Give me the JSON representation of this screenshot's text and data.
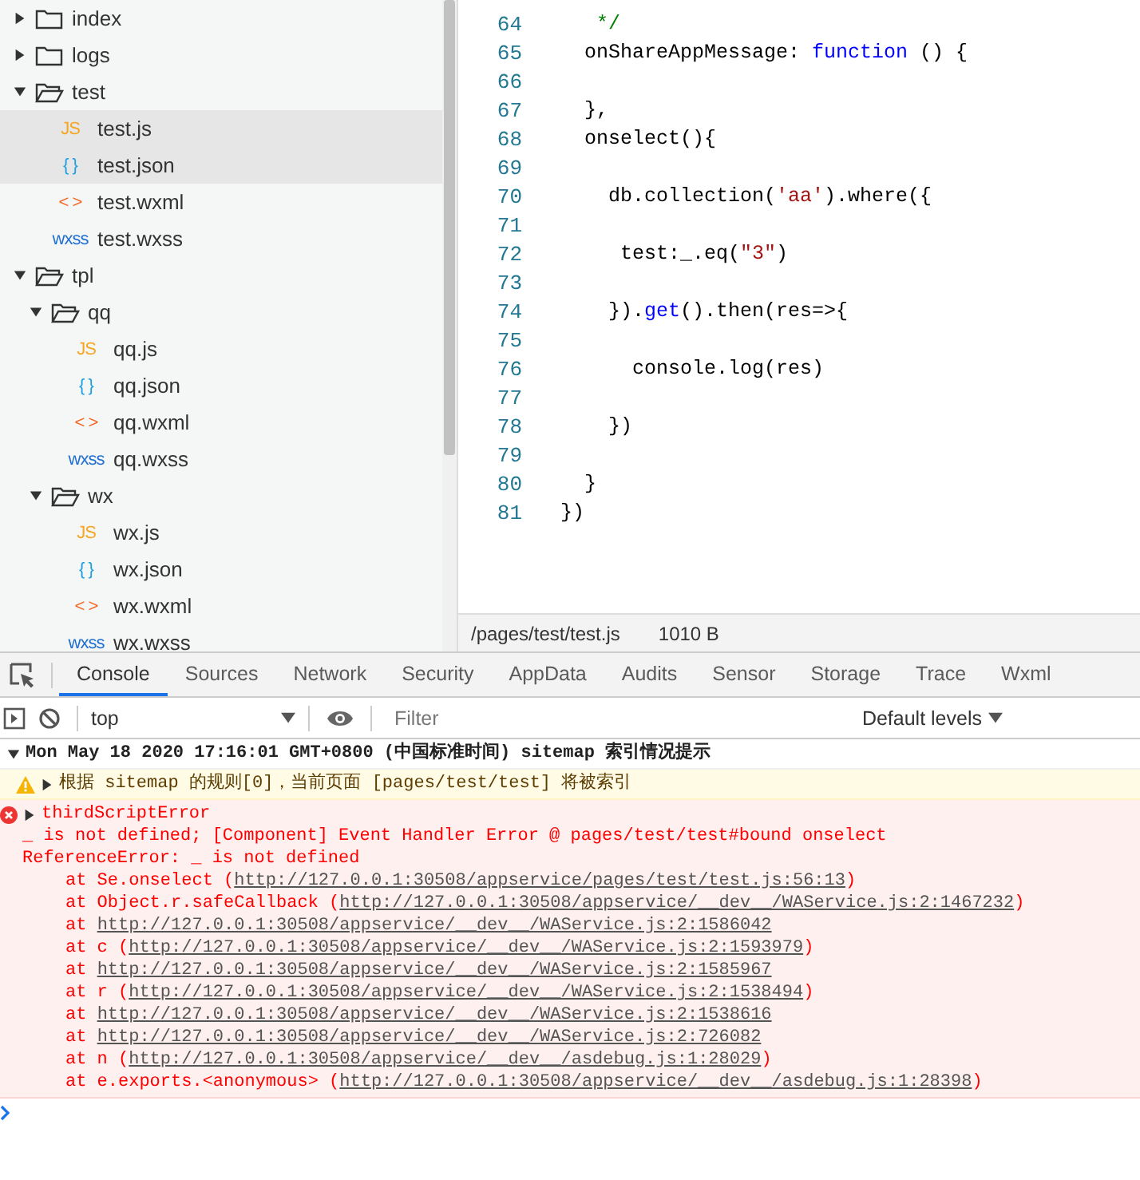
{
  "file_tree": [
    {
      "name": "index",
      "kind": "folder",
      "expanded": false,
      "selected": false
    },
    {
      "name": "logs",
      "kind": "folder",
      "expanded": false,
      "selected": false
    },
    {
      "name": "test",
      "kind": "folder",
      "expanded": true,
      "selected": false,
      "children": [
        {
          "name": "test.js",
          "kind": "js",
          "icon": "JS",
          "selected": true
        },
        {
          "name": "test.json",
          "kind": "json",
          "icon": "{ }",
          "selected": true
        },
        {
          "name": "test.wxml",
          "kind": "wxml",
          "icon": "< >",
          "selected": false
        },
        {
          "name": "test.wxss",
          "kind": "wxss",
          "icon": "wxss",
          "selected": false
        }
      ]
    },
    {
      "name": "tpl",
      "kind": "folder",
      "expanded": true,
      "selected": false,
      "children": [
        {
          "name": "qq",
          "kind": "folder",
          "expanded": true,
          "selected": false,
          "children": [
            {
              "name": "qq.js",
              "kind": "js",
              "icon": "JS",
              "selected": false
            },
            {
              "name": "qq.json",
              "kind": "json",
              "icon": "{ }",
              "selected": false
            },
            {
              "name": "qq.wxml",
              "kind": "wxml",
              "icon": "< >",
              "selected": false
            },
            {
              "name": "qq.wxss",
              "kind": "wxss",
              "icon": "wxss",
              "selected": false
            }
          ]
        },
        {
          "name": "wx",
          "kind": "folder",
          "expanded": true,
          "selected": false,
          "children": [
            {
              "name": "wx.js",
              "kind": "js",
              "icon": "JS",
              "selected": false
            },
            {
              "name": "wx.json",
              "kind": "json",
              "icon": "{ }",
              "selected": false
            },
            {
              "name": "wx.wxml",
              "kind": "wxml",
              "icon": "< >",
              "selected": false
            },
            {
              "name": "wx.wxss",
              "kind": "wxss",
              "icon": "wxss",
              "selected": false
            }
          ]
        }
      ]
    }
  ],
  "code_lines": [
    {
      "number": "64",
      "segments": [
        {
          "text": "   */",
          "kind": "comment"
        }
      ]
    },
    {
      "number": "65",
      "segments": [
        {
          "text": "  onShareAppMessage: ",
          "kind": "plain"
        },
        {
          "text": "function",
          "kind": "keyword"
        },
        {
          "text": " () {",
          "kind": "plain"
        }
      ]
    },
    {
      "number": "66"
    },
    {
      "number": "67",
      "segments": [
        {
          "text": "  },",
          "kind": "plain"
        }
      ]
    },
    {
      "number": "68",
      "segments": [
        {
          "text": "  onselect(){",
          "kind": "plain"
        }
      ]
    },
    {
      "number": "69"
    },
    {
      "number": "70",
      "segments": [
        {
          "text": "    db.collection(",
          "kind": "plain"
        },
        {
          "text": "'aa'",
          "kind": "string"
        },
        {
          "text": ").where({",
          "kind": "plain"
        }
      ]
    },
    {
      "number": "71"
    },
    {
      "number": "72",
      "segments": [
        {
          "text": "     test:_.eq(",
          "kind": "plain"
        },
        {
          "text": "\"3\"",
          "kind": "string"
        },
        {
          "text": ")",
          "kind": "plain"
        }
      ]
    },
    {
      "number": "73"
    },
    {
      "number": "74",
      "segments": [
        {
          "text": "    }).",
          "kind": "plain"
        },
        {
          "text": "get",
          "kind": "keyword"
        },
        {
          "text": "().then(res=>{",
          "kind": "plain"
        }
      ]
    },
    {
      "number": "75"
    },
    {
      "number": "76",
      "segments": [
        {
          "text": "      console.log(res)",
          "kind": "plain"
        }
      ]
    },
    {
      "number": "77"
    },
    {
      "number": "78",
      "segments": [
        {
          "text": "    })",
          "kind": "plain"
        }
      ]
    },
    {
      "number": "79"
    },
    {
      "number": "80",
      "segments": [
        {
          "text": "  }",
          "kind": "plain"
        }
      ]
    },
    {
      "number": "81",
      "segments": [
        {
          "text": "})",
          "kind": "plain"
        }
      ]
    }
  ],
  "status_bar": {
    "path": "/pages/test/test.js",
    "size": "1010 B"
  },
  "devtools_tabs": [
    {
      "label": "Console",
      "selected": true
    },
    {
      "label": "Sources",
      "selected": false
    },
    {
      "label": "Network",
      "selected": false
    },
    {
      "label": "Security",
      "selected": false
    },
    {
      "label": "AppData",
      "selected": false
    },
    {
      "label": "Audits",
      "selected": false
    },
    {
      "label": "Sensor",
      "selected": false
    },
    {
      "label": "Storage",
      "selected": false
    },
    {
      "label": "Trace",
      "selected": false
    },
    {
      "label": "Wxml",
      "selected": false
    }
  ],
  "console_toolbar": {
    "context": "top",
    "filter_placeholder": "Filter",
    "levels": "Default levels"
  },
  "console_messages": [
    {
      "kind": "group",
      "expanded": true,
      "text": "Mon May 18 2020 17:16:01 GMT+0800 (中国标准时间) sitemap 索引情况提示"
    },
    {
      "kind": "warning",
      "expanded": false,
      "text": "根据 sitemap 的规则[0]，当前页面 [pages/test/test] 将被索引"
    },
    {
      "kind": "error",
      "expanded": false,
      "text": "thirdScriptError",
      "lines": [
        "_ is not defined; [Component] Event Handler Error @ pages/test/test#bound onselect",
        "ReferenceError: _ is not defined"
      ],
      "stack": [
        {
          "prefix": "at Se.onselect (",
          "url": "http://127.0.0.1:30508/appservice/pages/test/test.js:56:13",
          "suffix": ")"
        },
        {
          "prefix": "at Object.r.safeCallback (",
          "url": "http://127.0.0.1:30508/appservice/__dev__/WAService.js:2:1467232",
          "suffix": ")"
        },
        {
          "prefix": "at ",
          "url": "http://127.0.0.1:30508/appservice/__dev__/WAService.js:2:1586042"
        },
        {
          "prefix": "at c (",
          "url": "http://127.0.0.1:30508/appservice/__dev__/WAService.js:2:1593979",
          "suffix": ")"
        },
        {
          "prefix": "at ",
          "url": "http://127.0.0.1:30508/appservice/__dev__/WAService.js:2:1585967"
        },
        {
          "prefix": "at r (",
          "url": "http://127.0.0.1:30508/appservice/__dev__/WAService.js:2:1538494",
          "suffix": ")"
        },
        {
          "prefix": "at ",
          "url": "http://127.0.0.1:30508/appservice/__dev__/WAService.js:2:1538616"
        },
        {
          "prefix": "at ",
          "url": "http://127.0.0.1:30508/appservice/__dev__/WAService.js:2:726082"
        },
        {
          "prefix": "at n (",
          "url": "http://127.0.0.1:30508/appservice/__dev__/asdebug.js:1:28029",
          "suffix": ")"
        },
        {
          "prefix": "at e.exports.<anonymous> (",
          "url": "http://127.0.0.1:30508/appservice/__dev__/asdebug.js:1:28398",
          "suffix": ")"
        }
      ]
    }
  ]
}
